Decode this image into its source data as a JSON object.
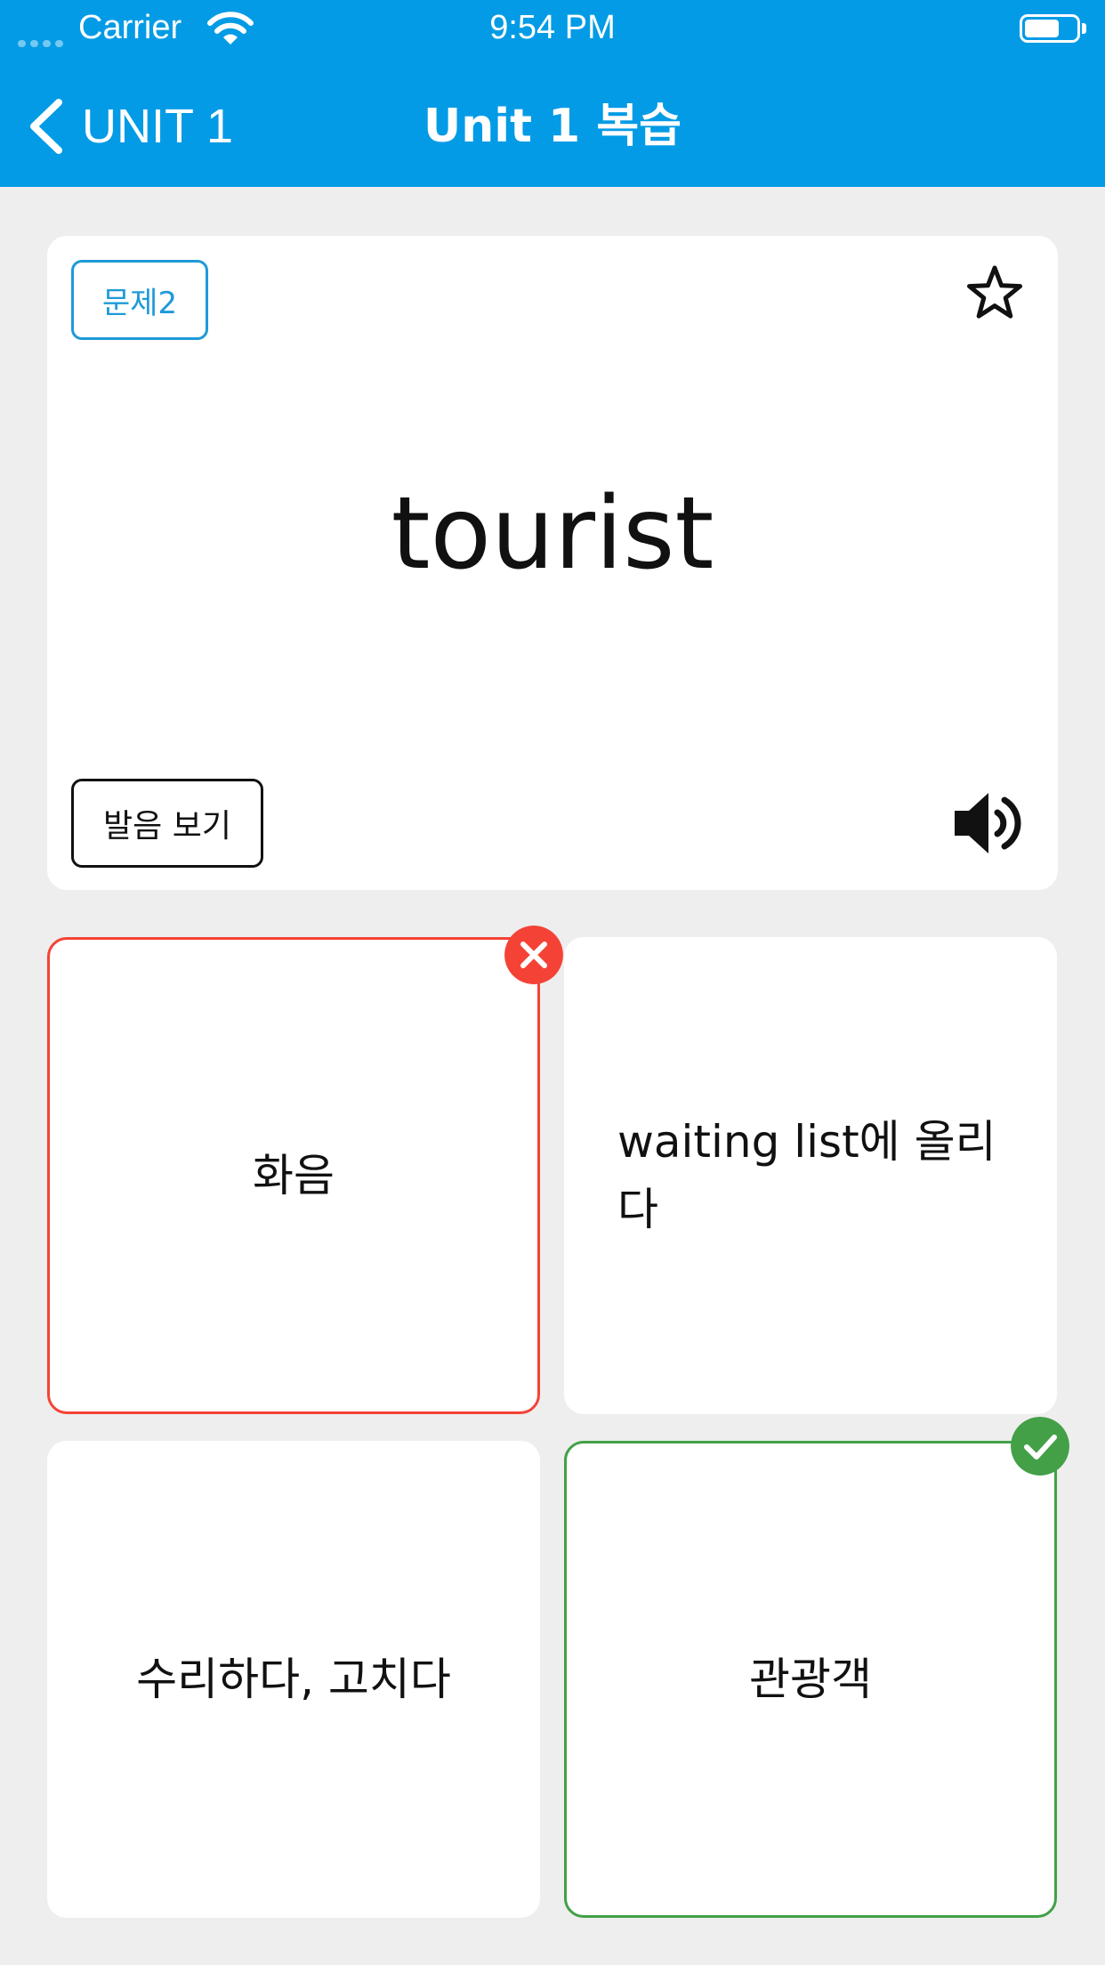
{
  "status_bar": {
    "carrier": "Carrier",
    "time": "9:54 PM"
  },
  "nav": {
    "back_label": "UNIT 1",
    "title": "Unit 1 복습"
  },
  "question": {
    "badge": "문제2",
    "word": "tourist",
    "pronunciation_button": "발음 보기",
    "favorited": false
  },
  "options": [
    {
      "text": "화음",
      "state": "wrong"
    },
    {
      "text": "waiting list에 올리다",
      "state": "neutral"
    },
    {
      "text": "수리하다, 고치다",
      "state": "neutral"
    },
    {
      "text": "관광객",
      "state": "correct"
    }
  ],
  "colors": {
    "accent": "#039be5",
    "badge": "#1e9ad8",
    "wrong": "#f44336",
    "correct": "#43a047",
    "background": "#eeeeee"
  }
}
